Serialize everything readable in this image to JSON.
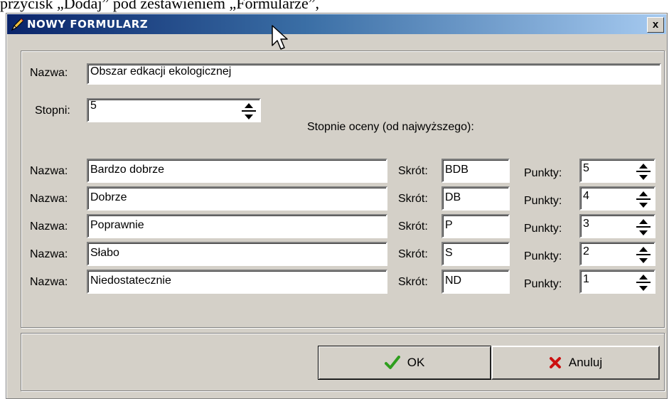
{
  "above_text": "przycisk „Dodaj” pod zestawieniem „Formularze”,",
  "window": {
    "title": "NOWY FORMULARZ",
    "close_label": "x"
  },
  "form": {
    "name_label": "Nazwa:",
    "name_value": "Obszar edkacji ekologicznej",
    "degrees_label": "Stopni:",
    "degrees_value": "5",
    "grades_heading": "Stopnie oceny (od najwyższego):"
  },
  "grades": [
    {
      "name_label": "Nazwa:",
      "name": "Bardzo dobrze",
      "abbr_label": "Skrót:",
      "abbr": "BDB",
      "points_label": "Punkty:",
      "points": "5"
    },
    {
      "name_label": "Nazwa:",
      "name": "Dobrze",
      "abbr_label": "Skrót:",
      "abbr": "DB",
      "points_label": "Punkty:",
      "points": "4"
    },
    {
      "name_label": "Nazwa:",
      "name": "Poprawnie",
      "abbr_label": "Skrót:",
      "abbr": "P",
      "points_label": "Punkty:",
      "points": "3"
    },
    {
      "name_label": "Nazwa:",
      "name": "Słabo",
      "abbr_label": "Skrót:",
      "abbr": "S",
      "points_label": "Punkty:",
      "points": "2"
    },
    {
      "name_label": "Nazwa:",
      "name": "Niedostatecznie",
      "abbr_label": "Skrót:",
      "abbr": "ND",
      "points_label": "Punkty:",
      "points": "1"
    }
  ],
  "buttons": {
    "ok_label": "OK",
    "cancel_label": "Anuluj"
  },
  "colors": {
    "titlebar_start": "#0a246a",
    "titlebar_end": "#a6caf0",
    "dialog_bg": "#d4d0c8",
    "ok_check": "#2e9e1e",
    "cancel_x": "#cc1010"
  }
}
